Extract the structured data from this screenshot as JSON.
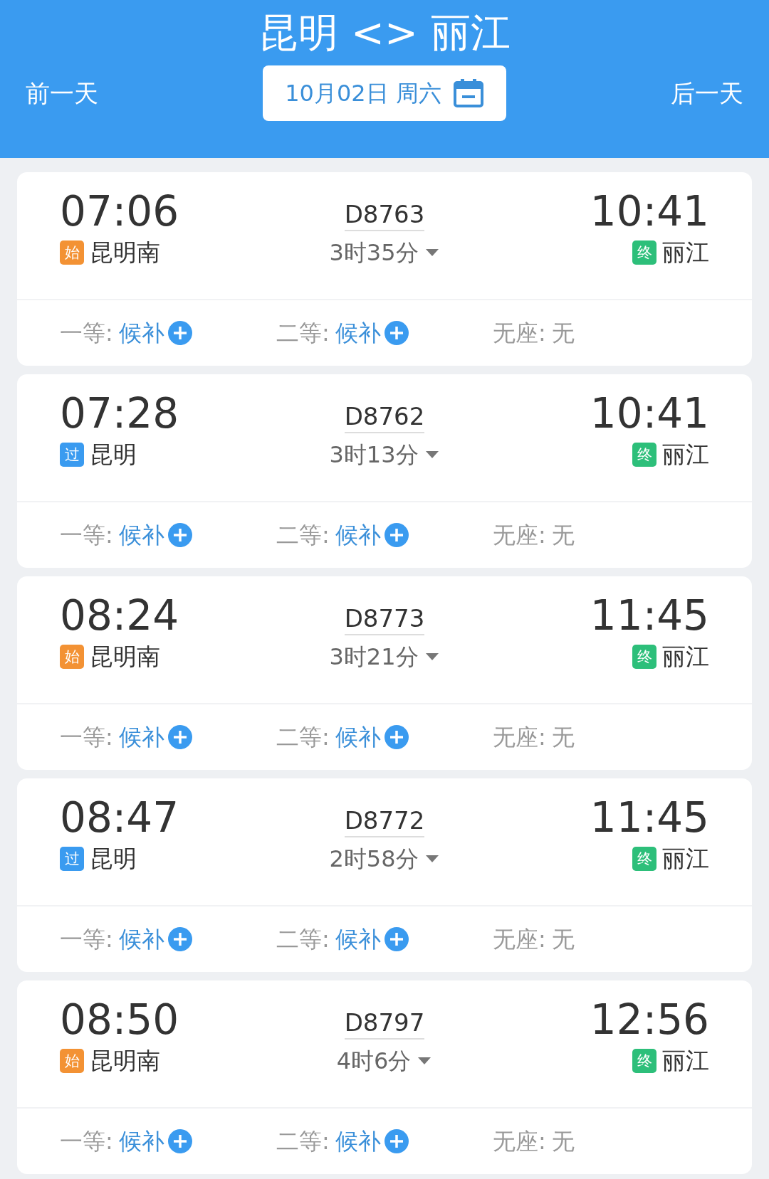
{
  "header": {
    "title": "昆明 <> 丽江",
    "prev_day": "前一天",
    "next_day": "后一天",
    "date": "10月02日 周六"
  },
  "trains": [
    {
      "depart_time": "07:06",
      "depart_badge": {
        "kind": "start",
        "text": "始"
      },
      "depart_station": "昆明南",
      "train_no": "D8763",
      "duration": "3时35分",
      "arrive_time": "10:41",
      "arrive_badge": {
        "kind": "end",
        "text": "终"
      },
      "arrive_station": "丽江",
      "seats": [
        {
          "label": "一等:",
          "value": "候补",
          "kind": "waitlist"
        },
        {
          "label": "二等:",
          "value": "候补",
          "kind": "waitlist"
        },
        {
          "label": "无座:",
          "value": "无",
          "kind": "none"
        }
      ]
    },
    {
      "depart_time": "07:28",
      "depart_badge": {
        "kind": "pass",
        "text": "过"
      },
      "depart_station": "昆明",
      "train_no": "D8762",
      "duration": "3时13分",
      "arrive_time": "10:41",
      "arrive_badge": {
        "kind": "end",
        "text": "终"
      },
      "arrive_station": "丽江",
      "seats": [
        {
          "label": "一等:",
          "value": "候补",
          "kind": "waitlist"
        },
        {
          "label": "二等:",
          "value": "候补",
          "kind": "waitlist"
        },
        {
          "label": "无座:",
          "value": "无",
          "kind": "none"
        }
      ]
    },
    {
      "depart_time": "08:24",
      "depart_badge": {
        "kind": "start",
        "text": "始"
      },
      "depart_station": "昆明南",
      "train_no": "D8773",
      "duration": "3时21分",
      "arrive_time": "11:45",
      "arrive_badge": {
        "kind": "end",
        "text": "终"
      },
      "arrive_station": "丽江",
      "seats": [
        {
          "label": "一等:",
          "value": "候补",
          "kind": "waitlist"
        },
        {
          "label": "二等:",
          "value": "候补",
          "kind": "waitlist"
        },
        {
          "label": "无座:",
          "value": "无",
          "kind": "none"
        }
      ]
    },
    {
      "depart_time": "08:47",
      "depart_badge": {
        "kind": "pass",
        "text": "过"
      },
      "depart_station": "昆明",
      "train_no": "D8772",
      "duration": "2时58分",
      "arrive_time": "11:45",
      "arrive_badge": {
        "kind": "end",
        "text": "终"
      },
      "arrive_station": "丽江",
      "seats": [
        {
          "label": "一等:",
          "value": "候补",
          "kind": "waitlist"
        },
        {
          "label": "二等:",
          "value": "候补",
          "kind": "waitlist"
        },
        {
          "label": "无座:",
          "value": "无",
          "kind": "none"
        }
      ]
    },
    {
      "depart_time": "08:50",
      "depart_badge": {
        "kind": "start",
        "text": "始"
      },
      "depart_station": "昆明南",
      "train_no": "D8797",
      "duration": "4时6分",
      "arrive_time": "12:56",
      "arrive_badge": {
        "kind": "end",
        "text": "终"
      },
      "arrive_station": "丽江",
      "seats": [
        {
          "label": "一等:",
          "value": "候补",
          "kind": "waitlist"
        },
        {
          "label": "二等:",
          "value": "候补",
          "kind": "waitlist"
        },
        {
          "label": "无座:",
          "value": "无",
          "kind": "none"
        }
      ]
    }
  ]
}
